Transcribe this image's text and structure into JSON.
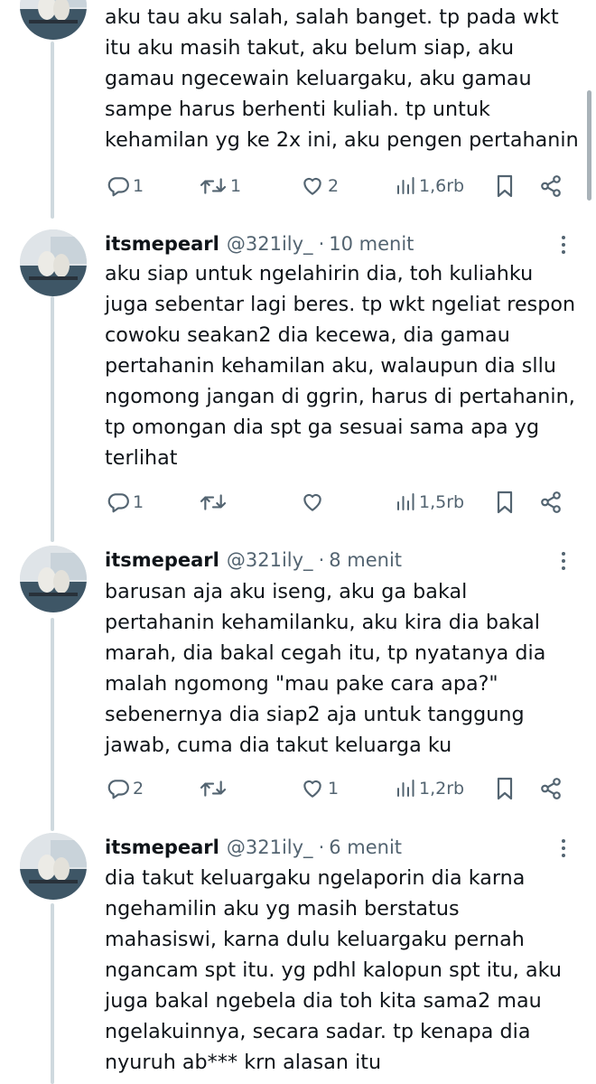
{
  "tweets": [
    {
      "name": "",
      "handle": "",
      "time": "",
      "lines": [
        "aku tau aku salah, salah banget. tp pada wkt",
        "itu aku masih takut, aku belum siap, aku",
        "gamau ngecewain keluargaku, aku gamau",
        "sampe harus berhenti kuliah. tp untuk",
        "kehamilan yg ke 2x ini, aku pengen pertahanin"
      ],
      "replies": "1",
      "retweets": "1",
      "likes": "2",
      "views": "1,6rb"
    },
    {
      "name": "itsmepearl",
      "handle": "@321ily_",
      "dot": "·",
      "time": "10 menit",
      "lines": [
        "aku siap untuk ngelahirin dia, toh kuliahku",
        "juga sebentar lagi beres. tp wkt ngeliat respon",
        "cowoku seakan2 dia kecewa, dia gamau",
        "pertahanin kehamilan aku, walaupun dia sllu",
        "ngomong jangan di ggrin, harus di pertahanin,",
        "tp omongan dia spt ga sesuai sama apa yg",
        "terlihat"
      ],
      "replies": "1",
      "retweets": "",
      "likes": "",
      "views": "1,5rb"
    },
    {
      "name": "itsmepearl",
      "handle": "@321ily_",
      "dot": "·",
      "time": "8 menit",
      "lines": [
        "barusan aja aku iseng, aku ga bakal",
        "pertahanin kehamilanku, aku kira dia bakal",
        "marah, dia bakal cegah itu, tp nyatanya dia",
        "malah ngomong \"mau pake cara apa?\"",
        "sebenernya dia siap2 aja untuk tanggung",
        "jawab, cuma dia takut keluarga ku"
      ],
      "replies": "2",
      "retweets": "",
      "likes": "1",
      "views": "1,2rb"
    },
    {
      "name": "itsmepearl",
      "handle": "@321ily_",
      "dot": "·",
      "time": "6 menit",
      "lines": [
        "dia takut keluargaku ngelaporin dia karna",
        "ngehamilin aku yg masih berstatus",
        "mahasiswi, karna dulu keluargaku pernah",
        "ngancam spt itu. yg pdhl kalopun spt itu, aku",
        "juga bakal ngebela dia toh kita sama2 mau",
        "ngelakuinnya, secara sadar. tp kenapa dia",
        "nyuruh ab*** krn alasan itu"
      ]
    }
  ],
  "icons": {
    "reply": "reply-icon",
    "retweet": "retweet-icon",
    "like": "heart-icon",
    "views": "views-icon",
    "bookmark": "bookmark-icon",
    "share": "share-icon",
    "more": "more-icon"
  },
  "colors": {
    "text": "#0f1419",
    "secondary": "#536471",
    "thread_line": "#cfd9de",
    "background": "#ffffff"
  }
}
